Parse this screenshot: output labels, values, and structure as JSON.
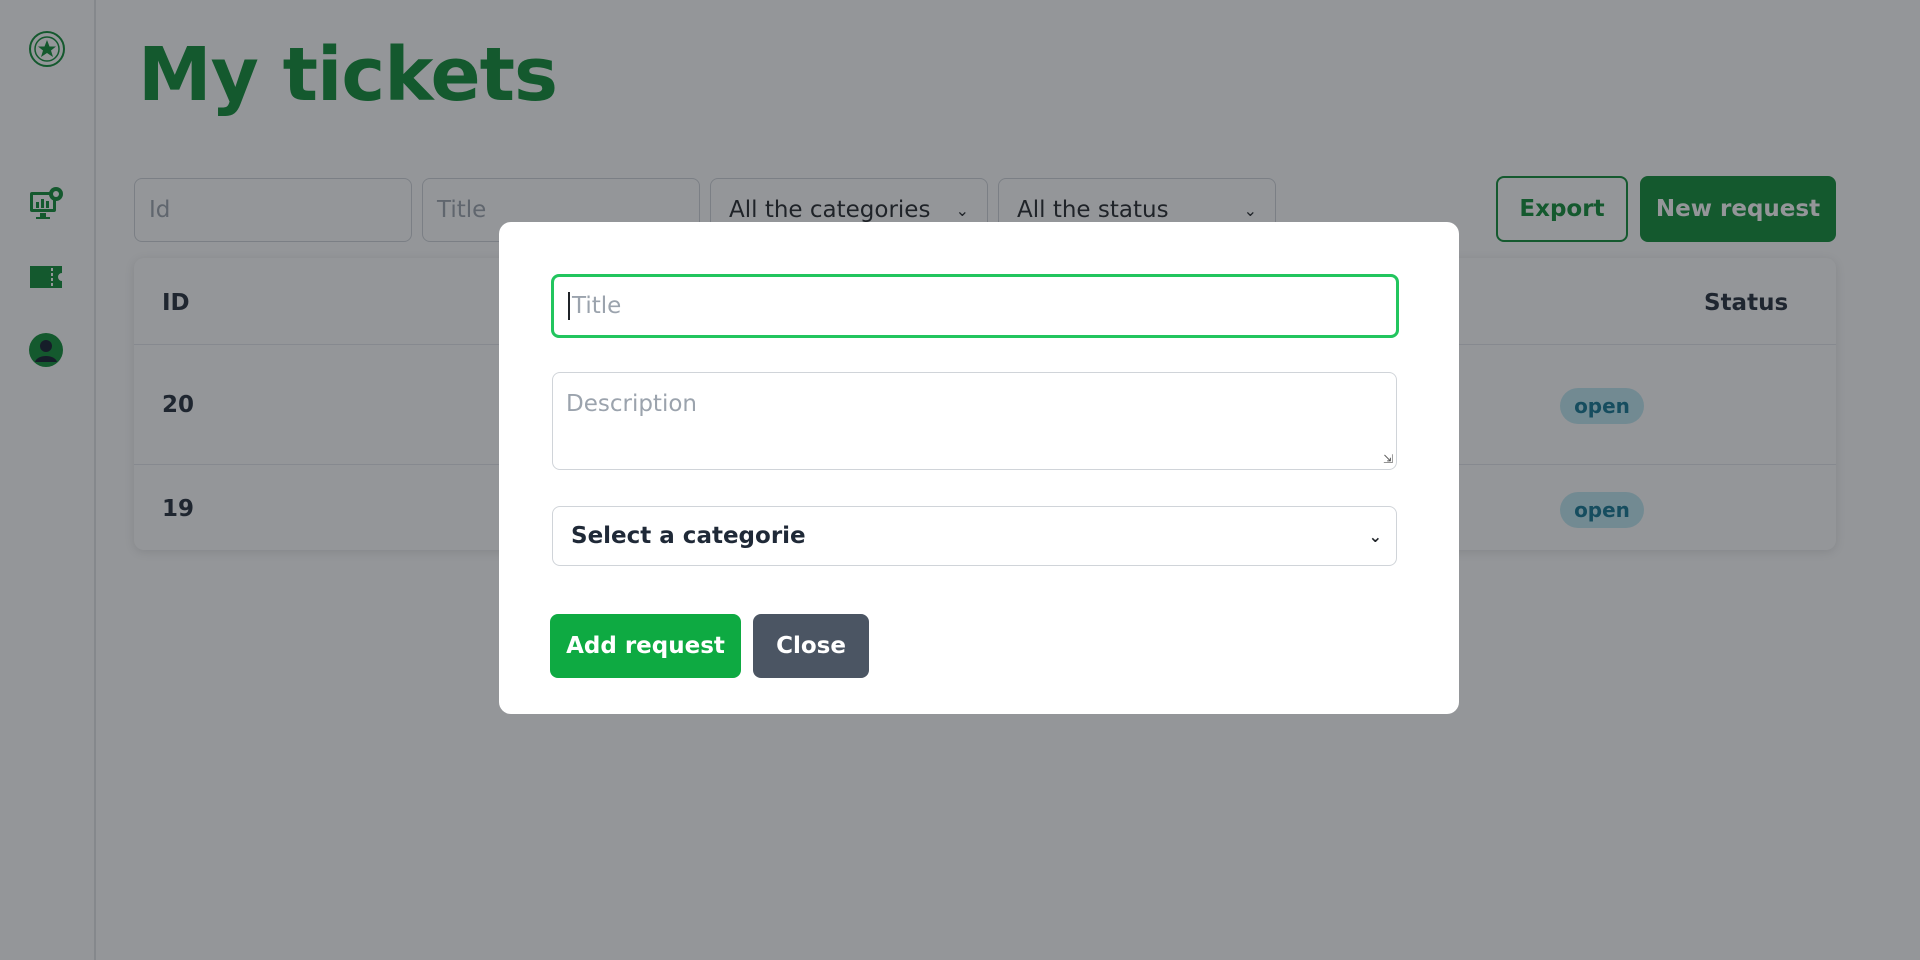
{
  "page": {
    "title": "My tickets"
  },
  "sidebar": {
    "logo_icon": "star-emblem-icon",
    "items": [
      {
        "icon": "dashboard-monitor-icon"
      },
      {
        "icon": "ticket-icon"
      },
      {
        "icon": "user-avatar-icon"
      }
    ]
  },
  "filters": {
    "id_placeholder": "Id",
    "title_placeholder": "Title",
    "category_selected": "All the categories",
    "status_selected": "All the status"
  },
  "toolbar": {
    "export_label": "Export",
    "new_request_label": "New request"
  },
  "table": {
    "columns": {
      "id": "ID",
      "status": "Status"
    },
    "rows": [
      {
        "id": "20",
        "status": "open"
      },
      {
        "id": "19",
        "status": "open"
      }
    ]
  },
  "modal": {
    "title_placeholder": "Title",
    "description_placeholder": "Description",
    "category_selected": "Select a categorie",
    "add_label": "Add request",
    "close_label": "Close"
  },
  "colors": {
    "brand_green": "#0b8a33",
    "focus_green": "#22c55e",
    "add_button": "#0eaa42",
    "close_button": "#4b5563",
    "badge_bg": "#bfe9f2",
    "badge_text": "#0e7490"
  }
}
